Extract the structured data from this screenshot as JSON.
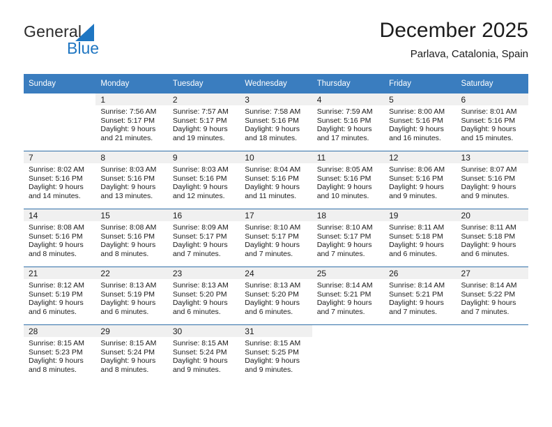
{
  "brand": {
    "name_part1": "General",
    "name_part2": "Blue",
    "triangle_icon": "triangle-icon",
    "accent_color": "#1f76c2"
  },
  "header": {
    "title": "December 2025",
    "location": "Parlava, Catalonia, Spain"
  },
  "calendar": {
    "header_bg": "#3a7dbf",
    "daynum_bg": "#f0f0f0",
    "grid_line_color": "#2f6ea8",
    "weekday_headers": [
      "Sunday",
      "Monday",
      "Tuesday",
      "Wednesday",
      "Thursday",
      "Friday",
      "Saturday"
    ],
    "weeks": [
      [
        {
          "day": "",
          "sunrise": "",
          "sunset": "",
          "daylight": ""
        },
        {
          "day": "1",
          "sunrise": "Sunrise: 7:56 AM",
          "sunset": "Sunset: 5:17 PM",
          "daylight": "Daylight: 9 hours and 21 minutes."
        },
        {
          "day": "2",
          "sunrise": "Sunrise: 7:57 AM",
          "sunset": "Sunset: 5:17 PM",
          "daylight": "Daylight: 9 hours and 19 minutes."
        },
        {
          "day": "3",
          "sunrise": "Sunrise: 7:58 AM",
          "sunset": "Sunset: 5:16 PM",
          "daylight": "Daylight: 9 hours and 18 minutes."
        },
        {
          "day": "4",
          "sunrise": "Sunrise: 7:59 AM",
          "sunset": "Sunset: 5:16 PM",
          "daylight": "Daylight: 9 hours and 17 minutes."
        },
        {
          "day": "5",
          "sunrise": "Sunrise: 8:00 AM",
          "sunset": "Sunset: 5:16 PM",
          "daylight": "Daylight: 9 hours and 16 minutes."
        },
        {
          "day": "6",
          "sunrise": "Sunrise: 8:01 AM",
          "sunset": "Sunset: 5:16 PM",
          "daylight": "Daylight: 9 hours and 15 minutes."
        }
      ],
      [
        {
          "day": "7",
          "sunrise": "Sunrise: 8:02 AM",
          "sunset": "Sunset: 5:16 PM",
          "daylight": "Daylight: 9 hours and 14 minutes."
        },
        {
          "day": "8",
          "sunrise": "Sunrise: 8:03 AM",
          "sunset": "Sunset: 5:16 PM",
          "daylight": "Daylight: 9 hours and 13 minutes."
        },
        {
          "day": "9",
          "sunrise": "Sunrise: 8:03 AM",
          "sunset": "Sunset: 5:16 PM",
          "daylight": "Daylight: 9 hours and 12 minutes."
        },
        {
          "day": "10",
          "sunrise": "Sunrise: 8:04 AM",
          "sunset": "Sunset: 5:16 PM",
          "daylight": "Daylight: 9 hours and 11 minutes."
        },
        {
          "day": "11",
          "sunrise": "Sunrise: 8:05 AM",
          "sunset": "Sunset: 5:16 PM",
          "daylight": "Daylight: 9 hours and 10 minutes."
        },
        {
          "day": "12",
          "sunrise": "Sunrise: 8:06 AM",
          "sunset": "Sunset: 5:16 PM",
          "daylight": "Daylight: 9 hours and 9 minutes."
        },
        {
          "day": "13",
          "sunrise": "Sunrise: 8:07 AM",
          "sunset": "Sunset: 5:16 PM",
          "daylight": "Daylight: 9 hours and 9 minutes."
        }
      ],
      [
        {
          "day": "14",
          "sunrise": "Sunrise: 8:08 AM",
          "sunset": "Sunset: 5:16 PM",
          "daylight": "Daylight: 9 hours and 8 minutes."
        },
        {
          "day": "15",
          "sunrise": "Sunrise: 8:08 AM",
          "sunset": "Sunset: 5:16 PM",
          "daylight": "Daylight: 9 hours and 8 minutes."
        },
        {
          "day": "16",
          "sunrise": "Sunrise: 8:09 AM",
          "sunset": "Sunset: 5:17 PM",
          "daylight": "Daylight: 9 hours and 7 minutes."
        },
        {
          "day": "17",
          "sunrise": "Sunrise: 8:10 AM",
          "sunset": "Sunset: 5:17 PM",
          "daylight": "Daylight: 9 hours and 7 minutes."
        },
        {
          "day": "18",
          "sunrise": "Sunrise: 8:10 AM",
          "sunset": "Sunset: 5:17 PM",
          "daylight": "Daylight: 9 hours and 7 minutes."
        },
        {
          "day": "19",
          "sunrise": "Sunrise: 8:11 AM",
          "sunset": "Sunset: 5:18 PM",
          "daylight": "Daylight: 9 hours and 6 minutes."
        },
        {
          "day": "20",
          "sunrise": "Sunrise: 8:11 AM",
          "sunset": "Sunset: 5:18 PM",
          "daylight": "Daylight: 9 hours and 6 minutes."
        }
      ],
      [
        {
          "day": "21",
          "sunrise": "Sunrise: 8:12 AM",
          "sunset": "Sunset: 5:19 PM",
          "daylight": "Daylight: 9 hours and 6 minutes."
        },
        {
          "day": "22",
          "sunrise": "Sunrise: 8:13 AM",
          "sunset": "Sunset: 5:19 PM",
          "daylight": "Daylight: 9 hours and 6 minutes."
        },
        {
          "day": "23",
          "sunrise": "Sunrise: 8:13 AM",
          "sunset": "Sunset: 5:20 PM",
          "daylight": "Daylight: 9 hours and 6 minutes."
        },
        {
          "day": "24",
          "sunrise": "Sunrise: 8:13 AM",
          "sunset": "Sunset: 5:20 PM",
          "daylight": "Daylight: 9 hours and 6 minutes."
        },
        {
          "day": "25",
          "sunrise": "Sunrise: 8:14 AM",
          "sunset": "Sunset: 5:21 PM",
          "daylight": "Daylight: 9 hours and 7 minutes."
        },
        {
          "day": "26",
          "sunrise": "Sunrise: 8:14 AM",
          "sunset": "Sunset: 5:21 PM",
          "daylight": "Daylight: 9 hours and 7 minutes."
        },
        {
          "day": "27",
          "sunrise": "Sunrise: 8:14 AM",
          "sunset": "Sunset: 5:22 PM",
          "daylight": "Daylight: 9 hours and 7 minutes."
        }
      ],
      [
        {
          "day": "28",
          "sunrise": "Sunrise: 8:15 AM",
          "sunset": "Sunset: 5:23 PM",
          "daylight": "Daylight: 9 hours and 8 minutes."
        },
        {
          "day": "29",
          "sunrise": "Sunrise: 8:15 AM",
          "sunset": "Sunset: 5:24 PM",
          "daylight": "Daylight: 9 hours and 8 minutes."
        },
        {
          "day": "30",
          "sunrise": "Sunrise: 8:15 AM",
          "sunset": "Sunset: 5:24 PM",
          "daylight": "Daylight: 9 hours and 9 minutes."
        },
        {
          "day": "31",
          "sunrise": "Sunrise: 8:15 AM",
          "sunset": "Sunset: 5:25 PM",
          "daylight": "Daylight: 9 hours and 9 minutes."
        },
        {
          "day": "",
          "sunrise": "",
          "sunset": "",
          "daylight": ""
        },
        {
          "day": "",
          "sunrise": "",
          "sunset": "",
          "daylight": ""
        },
        {
          "day": "",
          "sunrise": "",
          "sunset": "",
          "daylight": ""
        }
      ]
    ]
  }
}
